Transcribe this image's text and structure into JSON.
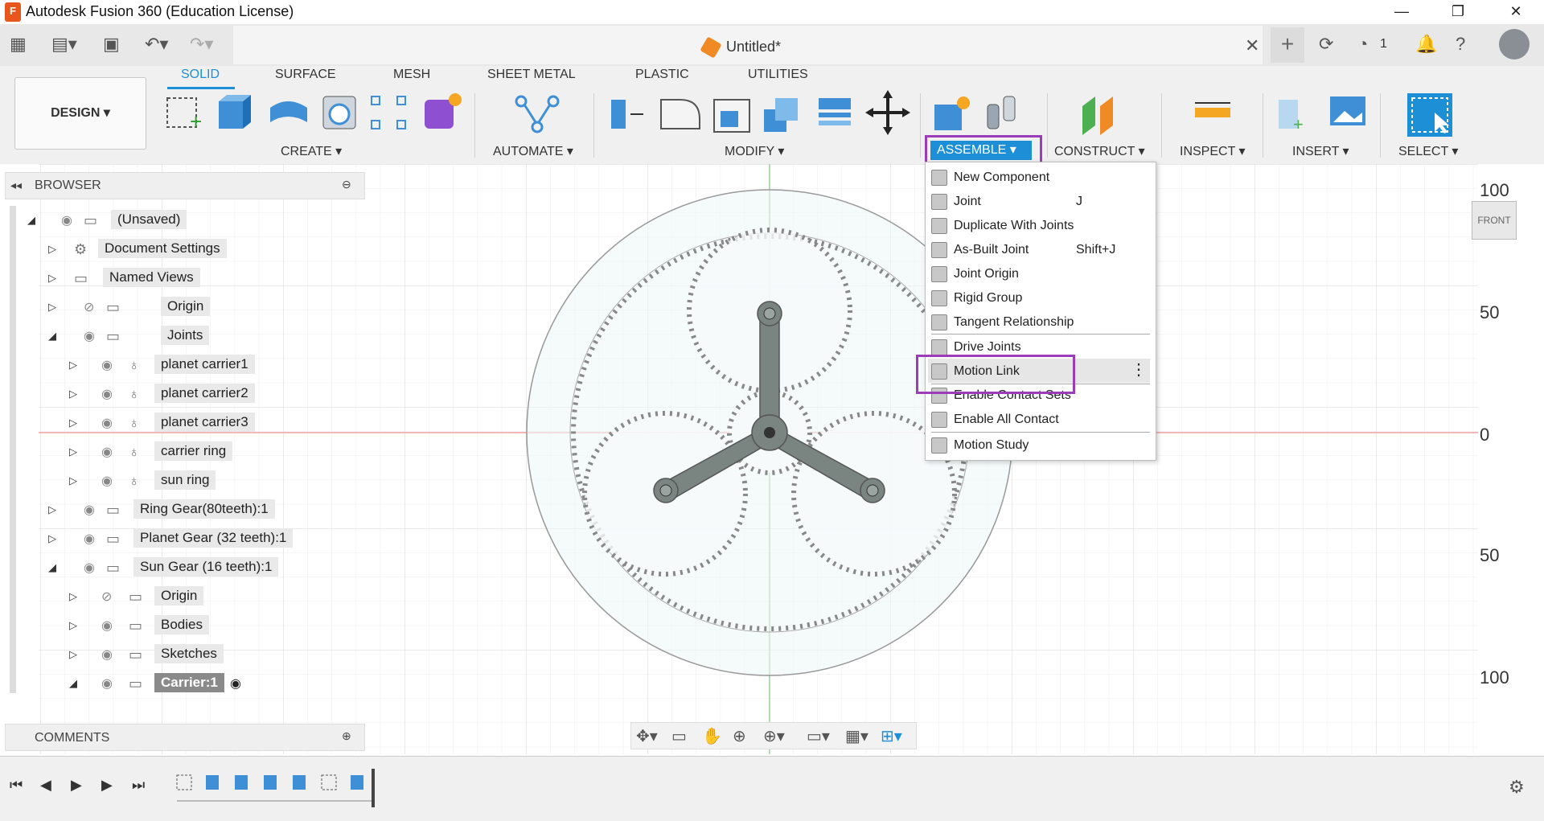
{
  "window": {
    "title": "Autodesk Fusion 360 (Education License)",
    "app_icon_label": "F",
    "controls": [
      "—",
      "❐",
      "✕"
    ]
  },
  "document": {
    "title": "Untitled*"
  },
  "qat": {
    "jobs_count": "1"
  },
  "workspace": {
    "label": "DESIGN ▾"
  },
  "tabs": [
    "SOLID",
    "SURFACE",
    "MESH",
    "SHEET METAL",
    "PLASTIC",
    "UTILITIES"
  ],
  "groups": {
    "create": "CREATE ▾",
    "automate": "AUTOMATE ▾",
    "modify": "MODIFY ▾",
    "assemble": "ASSEMBLE ▾",
    "construct": "CONSTRUCT ▾",
    "inspect": "INSPECT ▾",
    "insert": "INSERT ▾",
    "select": "SELECT ▾"
  },
  "browser": {
    "title": "BROWSER",
    "items": [
      {
        "label": "(Unsaved)"
      },
      {
        "label": "Document Settings"
      },
      {
        "label": "Named Views"
      },
      {
        "label": "Origin"
      },
      {
        "label": "Joints"
      },
      {
        "label": "planet carrier1"
      },
      {
        "label": "planet carrier2"
      },
      {
        "label": "planet carrier3"
      },
      {
        "label": "carrier ring"
      },
      {
        "label": "sun ring"
      },
      {
        "label": "Ring Gear(80teeth):1"
      },
      {
        "label": "Planet Gear (32 teeth):1"
      },
      {
        "label": "Sun Gear (16 teeth):1"
      },
      {
        "label": "Origin"
      },
      {
        "label": "Bodies"
      },
      {
        "label": "Sketches"
      },
      {
        "label": "Carrier:1"
      }
    ]
  },
  "comments": {
    "title": "COMMENTS"
  },
  "assemble_menu": {
    "items": [
      {
        "label": "New Component",
        "shortcut": ""
      },
      {
        "label": "Joint",
        "shortcut": "J"
      },
      {
        "label": "Duplicate With Joints",
        "shortcut": ""
      },
      {
        "label": "As-Built Joint",
        "shortcut": "Shift+J"
      },
      {
        "label": "Joint Origin",
        "shortcut": ""
      },
      {
        "label": "Rigid Group",
        "shortcut": ""
      },
      {
        "label": "Tangent Relationship",
        "shortcut": ""
      },
      {
        "label": "Drive Joints",
        "shortcut": ""
      },
      {
        "label": "Motion Link",
        "shortcut": ""
      },
      {
        "label": "Enable Contact Sets",
        "shortcut": ""
      },
      {
        "label": "Enable All Contact",
        "shortcut": ""
      },
      {
        "label": "Motion Study",
        "shortcut": ""
      }
    ],
    "more_icon": "⋮"
  },
  "viewcube": {
    "face": "FRONT"
  },
  "axis_labels": [
    "100",
    "50",
    "0",
    "50",
    "100"
  ],
  "colors": {
    "accent": "#1d8fd6",
    "highlight": "#9b3db8",
    "carrier": "#7a8582"
  }
}
